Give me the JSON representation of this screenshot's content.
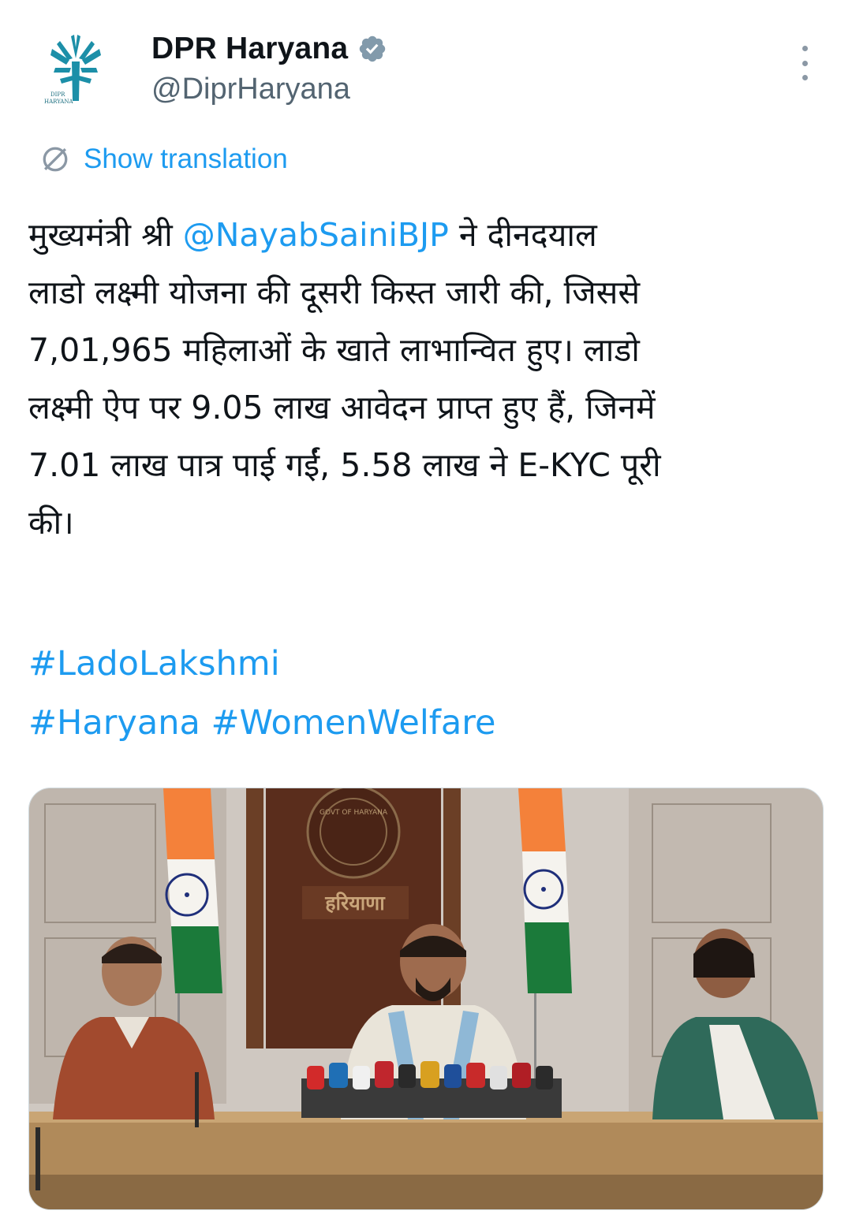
{
  "author": {
    "display_name": "DPR Haryana",
    "handle": "@DiprHaryana",
    "verified": true,
    "avatar_logo_text": "DIPR HARYANA"
  },
  "translate": {
    "icon": "globe-translate-icon",
    "label": "Show translation"
  },
  "tweet": {
    "lines": [
      {
        "before": "मुख्यमंत्री श्री ",
        "mention": "@NayabSainiBJP",
        "after": " ने दीनदयाल"
      },
      {
        "text": "लाडो लक्ष्मी योजना की दूसरी किस्त जारी की, जिससे"
      },
      {
        "text": "7,01,965 महिलाओं के खाते लाभान्वित हुए। लाडो"
      },
      {
        "text": "लक्ष्मी ऐप पर 9.05 लाख आवेदन प्राप्त हुए हैं, जिनमें"
      },
      {
        "text": "7.01 लाख पात्र पाई गईं, 5.58 लाख ने E-KYC पूरी"
      },
      {
        "text": "की।"
      }
    ]
  },
  "hashtags": {
    "line1": "#LadoLakshmi",
    "line2a": "#Haryana",
    "line2b": "#WomenWelfare"
  },
  "media": {
    "sign_text": "हरियाणा",
    "emblem_text": "GOVT OF HARYANA"
  },
  "colors": {
    "link": "#1d9bf0",
    "text": "#0f1419",
    "secondary": "#536471",
    "saffron": "#f4813a",
    "india_green": "#1b7a3a",
    "logo_teal": "#1c8fa8"
  }
}
